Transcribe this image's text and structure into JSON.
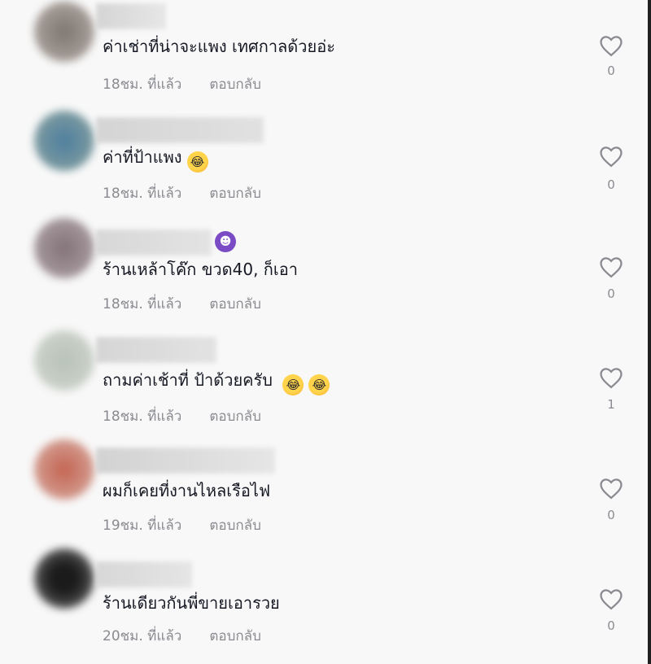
{
  "colors": {
    "text": "#161823",
    "secondary": "#8a8b91",
    "background": "#f8f8f8",
    "badge": "#7a4bc4"
  },
  "comments": [
    {
      "text": "ค่าเช่าที่น่าจะแพง เทศกาลด้วยอ่ะ",
      "time": "18ชม. ที่แล้ว",
      "reply": "ตอบกลับ",
      "likes": "0",
      "emojis": []
    },
    {
      "text": "ค่าที่ป้าแพง",
      "time": "18ชม. ที่แล้ว",
      "reply": "ตอบกลับ",
      "likes": "0",
      "emojis": [
        "laughing-emoji"
      ]
    },
    {
      "text": "ร้านเหล้าโค๊ก ขวด40, ก็เอา",
      "time": "18ชม. ที่แล้ว",
      "reply": "ตอบกลับ",
      "likes": "0",
      "emojis": []
    },
    {
      "text": "ถามค่าเช้าที่ ป้าด้วยครับ ",
      "time": "18ชม. ที่แล้ว",
      "reply": "ตอบกลับ",
      "likes": "1",
      "emojis": [
        "laughing-emoji",
        "laughing-emoji"
      ]
    },
    {
      "text": "ผมก็เคยที่งานไหลเรือไฟ",
      "time": "19ชม. ที่แล้ว",
      "reply": "ตอบกลับ",
      "likes": "0",
      "emojis": []
    },
    {
      "text": "ร้านเดียวกันพี่ขายเอารวย",
      "time": "20ชม. ที่แล้ว",
      "reply": "ตอบกลับ",
      "likes": "0",
      "emojis": []
    }
  ]
}
